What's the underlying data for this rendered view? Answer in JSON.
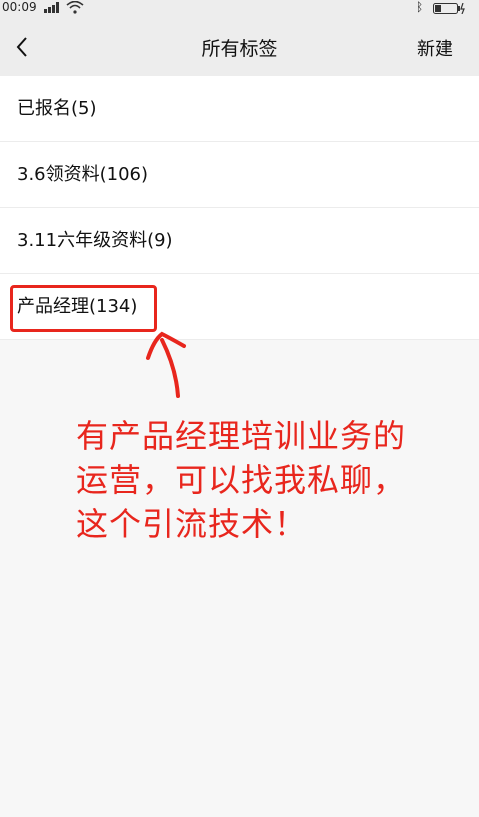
{
  "status_bar": {
    "time": "00:09",
    "icons": [
      "signal-icon",
      "wifi-icon",
      "bluetooth-icon",
      "battery-icon"
    ]
  },
  "nav": {
    "back_icon": "chevron-left-icon",
    "title": "所有标签",
    "new_label": "新建"
  },
  "tags": [
    "已报名(5)",
    "3.6领资料(106)",
    "3.11六年级资料(9)",
    "产品经理(134)"
  ],
  "annotation": {
    "lines": [
      "有产品经理培训业务的",
      "运营，可以找我私聊，",
      "这个引流技术！"
    ],
    "color": "#e8261d"
  }
}
